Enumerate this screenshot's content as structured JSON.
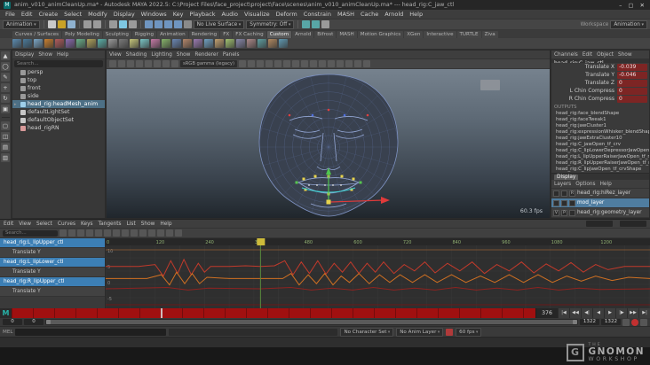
{
  "window": {
    "title": "anim_v010_animCleanUp.ma* - Autodesk MAYA 2022.5: C:\\Project Files\\face_project\\project\\Face\\scenes\\anim_v010_animCleanUp.ma* --- head_rig:C_jaw_ctl",
    "app_initial": "M",
    "minimize": "–",
    "maximize": "▢",
    "close": "✕"
  },
  "menu_bar": {
    "items": [
      "File",
      "Edit",
      "Create",
      "Select",
      "Modify",
      "Display",
      "Windows",
      "Key",
      "Playback",
      "Audio",
      "Visualize",
      "Deform",
      "Constrain",
      "MASH",
      "Cache",
      "Arnold",
      "Help"
    ]
  },
  "status_line": {
    "items": [
      {
        "type": "dropdown",
        "name": "menu-set-dropdown",
        "label": "Animation"
      },
      {
        "type": "divider"
      },
      {
        "type": "icon",
        "name": "new-scene-icon",
        "color": "#c9c9c9"
      },
      {
        "type": "icon",
        "name": "open-scene-icon",
        "color": "#c9a227"
      },
      {
        "type": "icon",
        "name": "save-scene-icon",
        "color": "#8fb2d0"
      },
      {
        "type": "divider"
      },
      {
        "type": "icon",
        "name": "undo-icon",
        "color": "#9a9a9a"
      },
      {
        "type": "icon",
        "name": "redo-icon",
        "color": "#9a9a9a"
      },
      {
        "type": "divider"
      },
      {
        "type": "icon",
        "name": "select-hierarchy-icon",
        "color": "#9a9a9a"
      },
      {
        "type": "icon",
        "name": "select-object-icon",
        "color": "#7ec8e3"
      },
      {
        "type": "icon",
        "name": "select-component-icon",
        "color": "#9a9a9a"
      },
      {
        "type": "divider"
      },
      {
        "type": "icon",
        "name": "snap-grid-icon",
        "color": "#6f95c0"
      },
      {
        "type": "icon",
        "name": "snap-curve-icon",
        "color": "#6f95c0"
      },
      {
        "type": "icon",
        "name": "snap-point-icon",
        "color": "#6f95c0"
      },
      {
        "type": "icon",
        "name": "snap-view-plane-icon",
        "color": "#6f95c0"
      },
      {
        "type": "icon",
        "name": "make-live-icon",
        "color": "#8a8a8a"
      },
      {
        "type": "dropdown",
        "name": "live-surface-dropdown",
        "label": "No Live Surface"
      },
      {
        "type": "dropdown",
        "name": "symmetry-dropdown",
        "label": "Symmetry: Off"
      },
      {
        "type": "divider"
      },
      {
        "type": "icon",
        "name": "render-icon",
        "color": "#58a6a6"
      },
      {
        "type": "icon",
        "name": "ipr-render-icon",
        "color": "#58a6a6"
      },
      {
        "type": "icon",
        "name": "render-settings-icon",
        "color": "#9a9a9a"
      },
      {
        "type": "spacer"
      },
      {
        "type": "label",
        "name": "workspace-label",
        "label": "Workspace"
      },
      {
        "type": "dropdown",
        "name": "workspace-dropdown",
        "label": "Animation"
      }
    ]
  },
  "shelf": {
    "tabs": [
      "Curves / Surfaces",
      "Poly Modeling",
      "Sculpting",
      "Rigging",
      "Animation",
      "Rendering",
      "FX",
      "FX Caching",
      "Custom",
      "Arnold",
      "Bifrost",
      "MASH",
      "Motion Graphics",
      "XGen",
      "Interactive",
      "TURTLE",
      "Ziva"
    ],
    "active": "Custom",
    "icon_colors": [
      "#5b8bb0",
      "#4a7a9a",
      "#7aa5c4",
      "#c97f2e",
      "#b05b5b",
      "#8a6bb0",
      "#6bb08a",
      "#b0a35b",
      "#5bb0a8",
      "#9a9a9a",
      "#7a7a7a",
      "#c4c47a",
      "#7ac4c4",
      "#c47aa5",
      "#86b36a",
      "#6a86b3",
      "#b3866a",
      "#9a7ab0",
      "#70a0c0",
      "#c0a070",
      "#a0c070",
      "#8888aa",
      "#aa8888",
      "#5f9ea0",
      "#b08860",
      "#6098b0"
    ]
  },
  "toolbox": {
    "tools": [
      {
        "name": "select-tool-icon",
        "glyph": "▲"
      },
      {
        "name": "lasso-select-tool-icon",
        "glyph": "◯"
      },
      {
        "name": "paint-select-tool-icon",
        "glyph": "✎"
      },
      {
        "name": "move-tool-icon",
        "glyph": "+"
      },
      {
        "name": "rotate-tool-icon",
        "glyph": "↻"
      },
      {
        "name": "scale-tool-icon",
        "glyph": "▣"
      }
    ],
    "layouts": [
      {
        "name": "single-pane-layout-icon",
        "glyph": "▢"
      },
      {
        "name": "four-pane-layout-icon",
        "glyph": "◫"
      },
      {
        "name": "persp-outliner-layout-icon",
        "glyph": "▤"
      },
      {
        "name": "hypershade-layout-icon",
        "glyph": "▥"
      }
    ]
  },
  "outliner": {
    "menus": [
      "Display",
      "Show",
      "Help"
    ],
    "search": "Search...",
    "items": [
      {
        "label": "persp",
        "type": "camera",
        "selected": false
      },
      {
        "label": "top",
        "type": "camera",
        "selected": false
      },
      {
        "label": "front",
        "type": "camera",
        "selected": false
      },
      {
        "label": "side",
        "type": "camera",
        "selected": false
      },
      {
        "label": "head_rig:headMesh_anim",
        "type": "transform",
        "selected": true
      },
      {
        "label": "defaultLightSet",
        "type": "set",
        "selected": false
      },
      {
        "label": "defaultObjectSet",
        "type": "set",
        "selected": false
      },
      {
        "label": "head_rigRN",
        "type": "reference",
        "selected": false
      }
    ]
  },
  "viewport": {
    "menus": [
      "View",
      "Shading",
      "Lighting",
      "Show",
      "Renderer",
      "Panels"
    ],
    "colorspace": "sRGB gamma (legacy)",
    "fps": "60.3 fps",
    "toolbar_icons": [
      "select-camera-icon",
      "lock-camera-icon",
      "camera-attributes-icon",
      "bookmarks-icon",
      "image-plane-icon",
      "2d-pan-zoom-icon",
      "grease-pencil-icon",
      "grid-icon",
      "film-gate-icon",
      "resolution-gate-icon",
      "gate-mask-icon",
      "field-chart-icon",
      "safe-action-icon",
      "safe-title-icon",
      "wireframe-icon",
      "shaded-icon",
      "textured-icon",
      "lights-icon",
      "shadows-icon",
      "screen-space-ao-icon",
      "motion-blur-icon",
      "xray-icon",
      "isolate-select-icon"
    ]
  },
  "channel_box": {
    "menus": [
      "Channels",
      "Edit",
      "Object",
      "Show"
    ],
    "object_name": "head_rig:C_jaw_ctl",
    "rows": [
      {
        "name": "Translate X",
        "value": "-0.039"
      },
      {
        "name": "Translate Y",
        "value": "-0.046"
      },
      {
        "name": "Translate Z",
        "value": "0"
      },
      {
        "name": "L Chin Compress",
        "value": "0"
      },
      {
        "name": "R Chin Compress",
        "value": "0"
      }
    ],
    "outputs_label": "OUTPUTS",
    "outputs": [
      "head_rig:face_blendShape",
      "head_rig:faceTweak1",
      "head_rig:jawCluster1",
      "head_rig:expressionWhisker_blendShape",
      "head_rig:jawExtraCluster10",
      "head_rig:C_jawOpen_tf_crv",
      "head_rig:C_lipLowerDepressorJawOpen_tf_md",
      "head_rig:L_lipUpperRaiserJawOpen_tf_md",
      "head_rig:R_lipUpperRaiserJawOpen_tf_md",
      "head_rig:C_lipJawOpen_tf_crvShape"
    ]
  },
  "layers": {
    "tab_display": "Display",
    "menus": [
      "Layers",
      "Options",
      "Help"
    ],
    "rows": [
      {
        "flags": [
          "",
          "",
          "R"
        ],
        "label": "head_rig:hiRez_layer",
        "selected": false
      },
      {
        "flags": [
          "",
          "",
          ""
        ],
        "label": "mod_layer",
        "selected": true
      },
      {
        "flags": [
          "V",
          "P",
          ""
        ],
        "label": "head_rig:geometry_layer",
        "selected": false
      }
    ]
  },
  "graph_editor": {
    "menus": [
      "Edit",
      "View",
      "Select",
      "Curves",
      "Keys",
      "Tangents",
      "List",
      "Show",
      "Help"
    ],
    "search": "Search...",
    "channels": [
      {
        "label": "head_rig:L_lipUpper_ctl",
        "selected": true,
        "indent": false
      },
      {
        "label": "Translate Y",
        "selected": false,
        "indent": true
      },
      {
        "label": "head_rig:L_lipLower_ctl",
        "selected": true,
        "indent": false
      },
      {
        "label": "Translate Y",
        "selected": false,
        "indent": true
      },
      {
        "label": "head_rig:R_lipUpper_ctl",
        "selected": true,
        "indent": false
      },
      {
        "label": "Translate Y",
        "selected": false,
        "indent": true
      }
    ],
    "frame_range": [
      0,
      1322
    ],
    "ruler_tick_step": 120,
    "value_ticks": [
      "10",
      "5",
      "0",
      "-5"
    ],
    "current_frame": "376",
    "curves": [
      {
        "color": "#c23a2b",
        "points": [
          [
            0,
            0.33
          ],
          [
            80,
            0.33
          ],
          [
            120,
            0.3
          ],
          [
            140,
            0.48
          ],
          [
            158,
            0.24
          ],
          [
            175,
            0.44
          ],
          [
            190,
            0.22
          ],
          [
            208,
            0.46
          ],
          [
            225,
            0.28
          ],
          [
            240,
            0.42
          ],
          [
            255,
            0.33
          ],
          [
            300,
            0.33
          ],
          [
            340,
            0.32
          ],
          [
            376,
            0.33
          ],
          [
            410,
            0.32
          ],
          [
            435,
            0.24
          ],
          [
            455,
            0.46
          ],
          [
            475,
            0.26
          ],
          [
            495,
            0.44
          ],
          [
            515,
            0.24
          ],
          [
            535,
            0.45
          ],
          [
            555,
            0.28
          ],
          [
            575,
            0.42
          ],
          [
            595,
            0.26
          ],
          [
            615,
            0.44
          ],
          [
            635,
            0.28
          ],
          [
            655,
            0.42
          ],
          [
            675,
            0.26
          ],
          [
            700,
            0.44
          ],
          [
            725,
            0.3
          ],
          [
            750,
            0.4
          ],
          [
            775,
            0.26
          ],
          [
            800,
            0.43
          ],
          [
            830,
            0.28
          ],
          [
            860,
            0.4
          ],
          [
            890,
            0.26
          ],
          [
            920,
            0.44
          ],
          [
            950,
            0.3
          ],
          [
            980,
            0.4
          ],
          [
            1010,
            0.26
          ],
          [
            1040,
            0.43
          ],
          [
            1070,
            0.29
          ],
          [
            1100,
            0.4
          ],
          [
            1130,
            0.27
          ],
          [
            1160,
            0.42
          ],
          [
            1190,
            0.3
          ],
          [
            1220,
            0.38
          ],
          [
            1260,
            0.33
          ],
          [
            1322,
            0.33
          ]
        ]
      },
      {
        "color": "#d07022",
        "points": [
          [
            0,
            0.52
          ],
          [
            100,
            0.52
          ],
          [
            135,
            0.46
          ],
          [
            155,
            0.62
          ],
          [
            172,
            0.42
          ],
          [
            192,
            0.6
          ],
          [
            210,
            0.44
          ],
          [
            228,
            0.6
          ],
          [
            246,
            0.5
          ],
          [
            300,
            0.52
          ],
          [
            376,
            0.52
          ],
          [
            430,
            0.52
          ],
          [
            450,
            0.44
          ],
          [
            470,
            0.62
          ],
          [
            492,
            0.46
          ],
          [
            512,
            0.6
          ],
          [
            532,
            0.44
          ],
          [
            552,
            0.62
          ],
          [
            572,
            0.48
          ],
          [
            592,
            0.58
          ],
          [
            615,
            0.44
          ],
          [
            640,
            0.6
          ],
          [
            665,
            0.46
          ],
          [
            690,
            0.58
          ],
          [
            715,
            0.46
          ],
          [
            745,
            0.58
          ],
          [
            775,
            0.46
          ],
          [
            805,
            0.58
          ],
          [
            840,
            0.46
          ],
          [
            875,
            0.58
          ],
          [
            910,
            0.48
          ],
          [
            945,
            0.58
          ],
          [
            980,
            0.46
          ],
          [
            1015,
            0.58
          ],
          [
            1050,
            0.46
          ],
          [
            1085,
            0.58
          ],
          [
            1120,
            0.48
          ],
          [
            1155,
            0.56
          ],
          [
            1190,
            0.48
          ],
          [
            1230,
            0.55
          ],
          [
            1270,
            0.5
          ],
          [
            1322,
            0.52
          ]
        ]
      },
      {
        "color": "#8e2320",
        "points": [
          [
            0,
            0.68
          ],
          [
            150,
            0.66
          ],
          [
            200,
            0.7
          ],
          [
            250,
            0.67
          ],
          [
            376,
            0.68
          ],
          [
            450,
            0.66
          ],
          [
            500,
            0.7
          ],
          [
            550,
            0.67
          ],
          [
            600,
            0.7
          ],
          [
            650,
            0.66
          ],
          [
            700,
            0.7
          ],
          [
            750,
            0.67
          ],
          [
            800,
            0.7
          ],
          [
            850,
            0.66
          ],
          [
            900,
            0.7
          ],
          [
            950,
            0.67
          ],
          [
            1000,
            0.7
          ],
          [
            1050,
            0.66
          ],
          [
            1100,
            0.7
          ],
          [
            1150,
            0.67
          ],
          [
            1200,
            0.69
          ],
          [
            1322,
            0.68
          ]
        ]
      },
      {
        "color": "#7a5230",
        "points": [
          [
            0,
            0.07
          ],
          [
            1322,
            0.07
          ]
        ]
      },
      {
        "color": "#6a1a1a",
        "points": [
          [
            0,
            0.93
          ],
          [
            1322,
            0.93
          ]
        ]
      }
    ]
  },
  "timeline": {
    "current_frame": "376"
  },
  "playback": {
    "buttons": [
      {
        "name": "go-to-start-button",
        "glyph": "|◀"
      },
      {
        "name": "step-back-key-button",
        "glyph": "◀◀"
      },
      {
        "name": "step-back-frame-button",
        "glyph": "◀|"
      },
      {
        "name": "play-backwards-button",
        "glyph": "◀"
      },
      {
        "name": "play-forwards-button",
        "glyph": "▶"
      },
      {
        "name": "step-forward-frame-button",
        "glyph": "|▶"
      },
      {
        "name": "step-forward-key-button",
        "glyph": "▶▶"
      },
      {
        "name": "go-to-end-button",
        "glyph": "▶|"
      }
    ]
  },
  "range": {
    "anim_start": "0",
    "playback_start": "0",
    "playback_end": "1322",
    "anim_end": "1322"
  },
  "command_line": {
    "label": "MEL"
  },
  "status_bottom": {
    "character_set": "No Character Set",
    "anim_layer": "No Anim Layer",
    "fps": "60 fps"
  },
  "watermark": {
    "logo": "G",
    "the": "THE",
    "gnomon": "GNOMON",
    "workshop": "WORKSHOP"
  }
}
